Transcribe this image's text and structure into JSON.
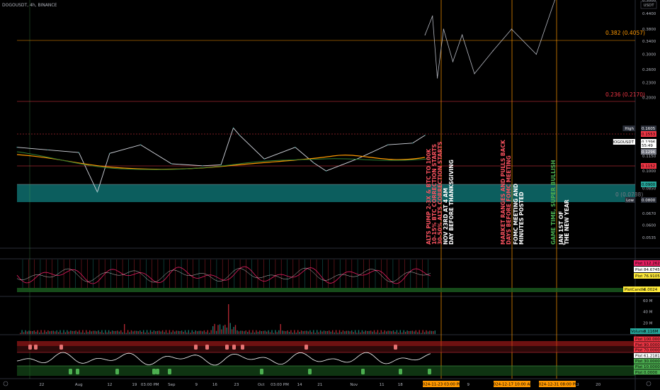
{
  "header": {
    "symbol_line": "DOGOUSDT, 4h, BINANCE",
    "currency": "USDT"
  },
  "price_axis": {
    "ticks": [
      {
        "v": 0.5,
        "label": "0.5000"
      },
      {
        "v": 0.44,
        "label": "0.4400"
      },
      {
        "v": 0.38,
        "label": "0.3800"
      },
      {
        "v": 0.34,
        "label": "0.3400"
      },
      {
        "v": 0.3,
        "label": "0.3000"
      },
      {
        "v": 0.26,
        "label": "0.2600"
      },
      {
        "v": 0.23,
        "label": "0.2300"
      },
      {
        "v": 0.2,
        "label": "0.2000"
      },
      {
        "v": 0.115,
        "label": "0.1150"
      },
      {
        "v": 0.1,
        "label": "0.1000"
      },
      {
        "v": 0.085,
        "label": "0.0850"
      },
      {
        "v": 0.075,
        "label": "0.0750"
      },
      {
        "v": 0.067,
        "label": "0.0670"
      },
      {
        "v": 0.06,
        "label": "0.0600"
      },
      {
        "v": 0.0535,
        "label": "0.0535"
      }
    ],
    "tags": [
      {
        "label": "High",
        "value": "0.1605",
        "color": "#2a2e39",
        "text": "light"
      },
      {
        "label": "",
        "value": "0.1553",
        "color": "#f23645",
        "text": "dark"
      },
      {
        "label": "DOGOUSDT",
        "value": "0.1396",
        "color": "#ffffff",
        "text": "dark"
      },
      {
        "label": "",
        "value": "55:49",
        "color": "#ffffff",
        "text": "dark"
      },
      {
        "label": "",
        "value": "0.1296",
        "color": "#787b86",
        "text": "light"
      },
      {
        "label": "",
        "value": "0.1152",
        "color": "#f23645",
        "text": "dark"
      },
      {
        "label": "",
        "value": "0.0900",
        "color": "#26a69a",
        "text": "dark"
      },
      {
        "label": "Low",
        "value": "0.0800",
        "color": "#2a2e39",
        "text": "light"
      }
    ]
  },
  "fib_levels": [
    {
      "label": "0.382 (0.4057)",
      "color": "#ff9800"
    },
    {
      "label": "0.236 (0.2170)",
      "color": "#f23645"
    },
    {
      "label": "0 (0.0788)",
      "color": "#787b86"
    }
  ],
  "annotations": [
    {
      "line1": "ALTS PUMP 2-3X & BTC TO 100K",
      "line2": "10-15% BTC CORRECTION STARTS",
      "line3": "30-50% ALTS CORRECTION STARTS",
      "color": "#f7525f"
    },
    {
      "line1": "NOV 23RD AT 4 AM",
      "line2": "DAY BEFORE THANKSGIVING",
      "line3": "",
      "color": "#ffffff"
    },
    {
      "line1": "MARKET RANGES AND PULLS BACK",
      "line2": "DAYS BEFORE FOMC MEETING",
      "line3": "",
      "color": "#f7525f"
    },
    {
      "line1": "FOMC MEETING AND",
      "line2": "MINUTES POSTED",
      "line3": "",
      "color": "#ffffff"
    },
    {
      "line1": "GAME TIME, SUPER BULLISH",
      "line2": "",
      "line3": "",
      "color": "#4caf50"
    },
    {
      "line1": "JAN 1ST OF",
      "line2": "THE NEW YEAR",
      "line3": "",
      "color": "#ffffff"
    }
  ],
  "osc_pane": {
    "tags": [
      {
        "label": "Plot",
        "value": "112.2628",
        "color": "#e91e63"
      },
      {
        "label": "Plot",
        "value": "84.6745",
        "color": "#ffffff"
      },
      {
        "label": "Plot",
        "value": "76.9105",
        "color": "#ffeb3b"
      }
    ],
    "plotcandle": {
      "label": "PlotCandle",
      "value": "6.0024",
      "color": "#ffeb3b"
    }
  },
  "volume_pane": {
    "ticks": [
      {
        "v": 60,
        "label": "60 M"
      },
      {
        "v": 40,
        "label": "40 M"
      },
      {
        "v": 20,
        "label": "20 M"
      }
    ],
    "tag": {
      "label": "Volume",
      "value": "9.116M",
      "color": "#26a69a"
    }
  },
  "rsi_pane": {
    "tags": [
      {
        "label": "Plot",
        "value": "100.0000",
        "color": "#f23645"
      },
      {
        "label": "Plot",
        "value": "90.0000",
        "color": "#f23645"
      },
      {
        "label": "Plot",
        "value": "70.0000",
        "color": "#f23645"
      },
      {
        "label": "Plot",
        "value": "61.2181",
        "color": "#ffffff"
      },
      {
        "label": "Plot",
        "value": "30.0000",
        "color": "#4caf50"
      },
      {
        "label": "Plot",
        "value": "10.0000",
        "color": "#4caf50"
      },
      {
        "label": "Plot",
        "value": "0.0000",
        "color": "#4caf50"
      }
    ]
  },
  "time_axis": {
    "labels": [
      {
        "frac": 0.04,
        "label": "22"
      },
      {
        "frac": 0.1,
        "label": "Aug"
      },
      {
        "frac": 0.15,
        "label": "12"
      },
      {
        "frac": 0.19,
        "label": "19"
      },
      {
        "frac": 0.215,
        "label": "03:00 PM"
      },
      {
        "frac": 0.25,
        "label": "Sep"
      },
      {
        "frac": 0.29,
        "label": "9"
      },
      {
        "frac": 0.32,
        "label": "16"
      },
      {
        "frac": 0.355,
        "label": "23"
      },
      {
        "frac": 0.395,
        "label": "Oct"
      },
      {
        "frac": 0.425,
        "label": "03:00 PM"
      },
      {
        "frac": 0.457,
        "label": "14"
      },
      {
        "frac": 0.49,
        "label": "21"
      },
      {
        "frac": 0.545,
        "label": "Nov"
      },
      {
        "frac": 0.59,
        "label": "11"
      },
      {
        "frac": 0.62,
        "label": "18"
      },
      {
        "frac": 0.73,
        "label": "9"
      },
      {
        "frac": 0.85,
        "label": "6"
      },
      {
        "frac": 0.905,
        "label": "13"
      },
      {
        "frac": 0.94,
        "label": "20"
      }
    ],
    "tags": [
      {
        "label": "2024-11-23 03:00 PM",
        "color": "#ff9800"
      },
      {
        "label": "2024-12-17 10:00 AM",
        "color": "#ff9800"
      },
      {
        "label": "2024-12-31 08:00 PM",
        "color": "#ff9800"
      }
    ]
  },
  "chart_data": {
    "type": "line",
    "title": "",
    "xlabel": "",
    "ylabel": "",
    "log_scale": true,
    "ylim": [
      0.05,
      0.5
    ],
    "series": [
      {
        "values_note_free": true,
        "x": [
          0,
          0.05,
          0.1,
          0.13,
          0.15,
          0.2,
          0.25,
          0.3,
          0.33,
          0.35,
          0.36,
          0.4,
          0.45,
          0.48,
          0.5,
          0.55,
          0.6,
          0.64,
          0.66
        ],
        "values": [
          0.125,
          0.122,
          0.119,
          0.082,
          0.118,
          0.128,
          0.107,
          0.105,
          0.106,
          0.15,
          0.14,
          0.112,
          0.125,
          0.108,
          0.1,
          0.112,
          0.128,
          0.13,
          0.14
        ]
      },
      {
        "x": [
          0.66,
          0.672,
          0.68,
          0.69,
          0.705,
          0.72,
          0.74,
          0.77,
          0.8,
          0.84,
          0.87
        ],
        "values": [
          0.36,
          0.43,
          0.24,
          0.38,
          0.28,
          0.36,
          0.25,
          0.31,
          0.38,
          0.3,
          0.5
        ]
      }
    ],
    "fib_values": [
      0.4057,
      0.217,
      0.0788
    ]
  }
}
